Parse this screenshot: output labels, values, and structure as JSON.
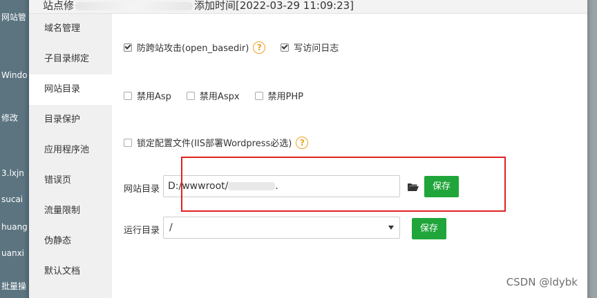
{
  "background": {
    "rows": [
      "网站管",
      "Windo",
      "修改",
      "3.lxjn",
      "sucai",
      "huang",
      "uanxi",
      "批量操"
    ]
  },
  "modal": {
    "title_prefix": "站点修",
    "title_suffix": "添加时间[2022-03-29 11:09:23]"
  },
  "sidebar": {
    "items": [
      {
        "label": "域名管理"
      },
      {
        "label": "子目录绑定"
      },
      {
        "label": "网站目录"
      },
      {
        "label": "目录保护"
      },
      {
        "label": "应用程序池"
      },
      {
        "label": "错误页"
      },
      {
        "label": "流量限制"
      },
      {
        "label": "伪静态"
      },
      {
        "label": "默认文档"
      }
    ],
    "active_index": 2
  },
  "options": {
    "anti_cross": {
      "label": "防跨站攻击(open_basedir)",
      "checked": true
    },
    "access_log": {
      "label": "写访问日志",
      "checked": true
    },
    "disable_asp": {
      "label": "禁用Asp",
      "checked": false
    },
    "disable_aspx": {
      "label": "禁用Aspx",
      "checked": false
    },
    "disable_php": {
      "label": "禁用PHP",
      "checked": false
    },
    "lock_config": {
      "label": "锁定配置文件(IIS部署Wordpress必选)",
      "checked": false
    },
    "help_glyph": "?"
  },
  "site_dir": {
    "label": "网站目录",
    "value": "D:/wwwroot/",
    "value_tail": ".",
    "save_label": "保存"
  },
  "run_dir": {
    "label": "运行目录",
    "selected": "/",
    "save_label": "保存"
  },
  "watermark": "CSDN @ldybk",
  "colors": {
    "accent_green": "#20a53a",
    "highlight_red": "#e02020",
    "help_orange": "#f0a020"
  }
}
